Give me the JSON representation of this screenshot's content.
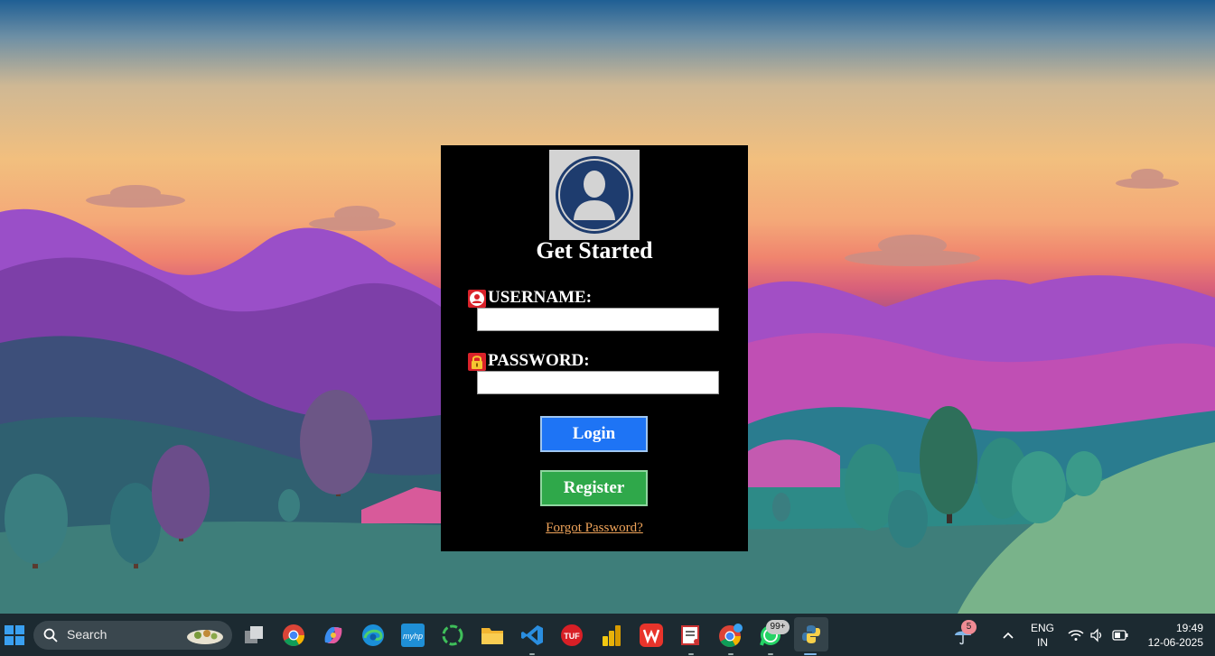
{
  "login": {
    "title": "Get Started",
    "username_label": "USERNAME:",
    "username_value": "",
    "password_label": "PASSWORD:",
    "password_value": "",
    "login_button": "Login",
    "register_button": "Register",
    "forgot_link": "Forgot Password?"
  },
  "taskbar": {
    "search_label": "Search",
    "language_line1": "ENG",
    "language_line2": "IN",
    "time": "19:49",
    "date": "12-06-2025",
    "weather_badge": "5",
    "whatsapp_badge": "99+",
    "apps": [
      "windows-start-icon",
      "task-view-icon",
      "chrome-icon",
      "copilot-icon",
      "edge-icon",
      "myhp-icon",
      "refresh-app-icon",
      "file-explorer-icon",
      "vscode-icon",
      "tuf-icon",
      "power-bi-icon",
      "wps-office-icon",
      "snipping-tool-icon",
      "chrome-profile-icon",
      "whatsapp-icon",
      "python-icon"
    ]
  },
  "colors": {
    "login_bg": "#000000",
    "login_button": "#1e74f5",
    "register_button": "#2fa84a",
    "forgot_link": "#f0a45a",
    "taskbar_bg": "#1c2a31"
  }
}
